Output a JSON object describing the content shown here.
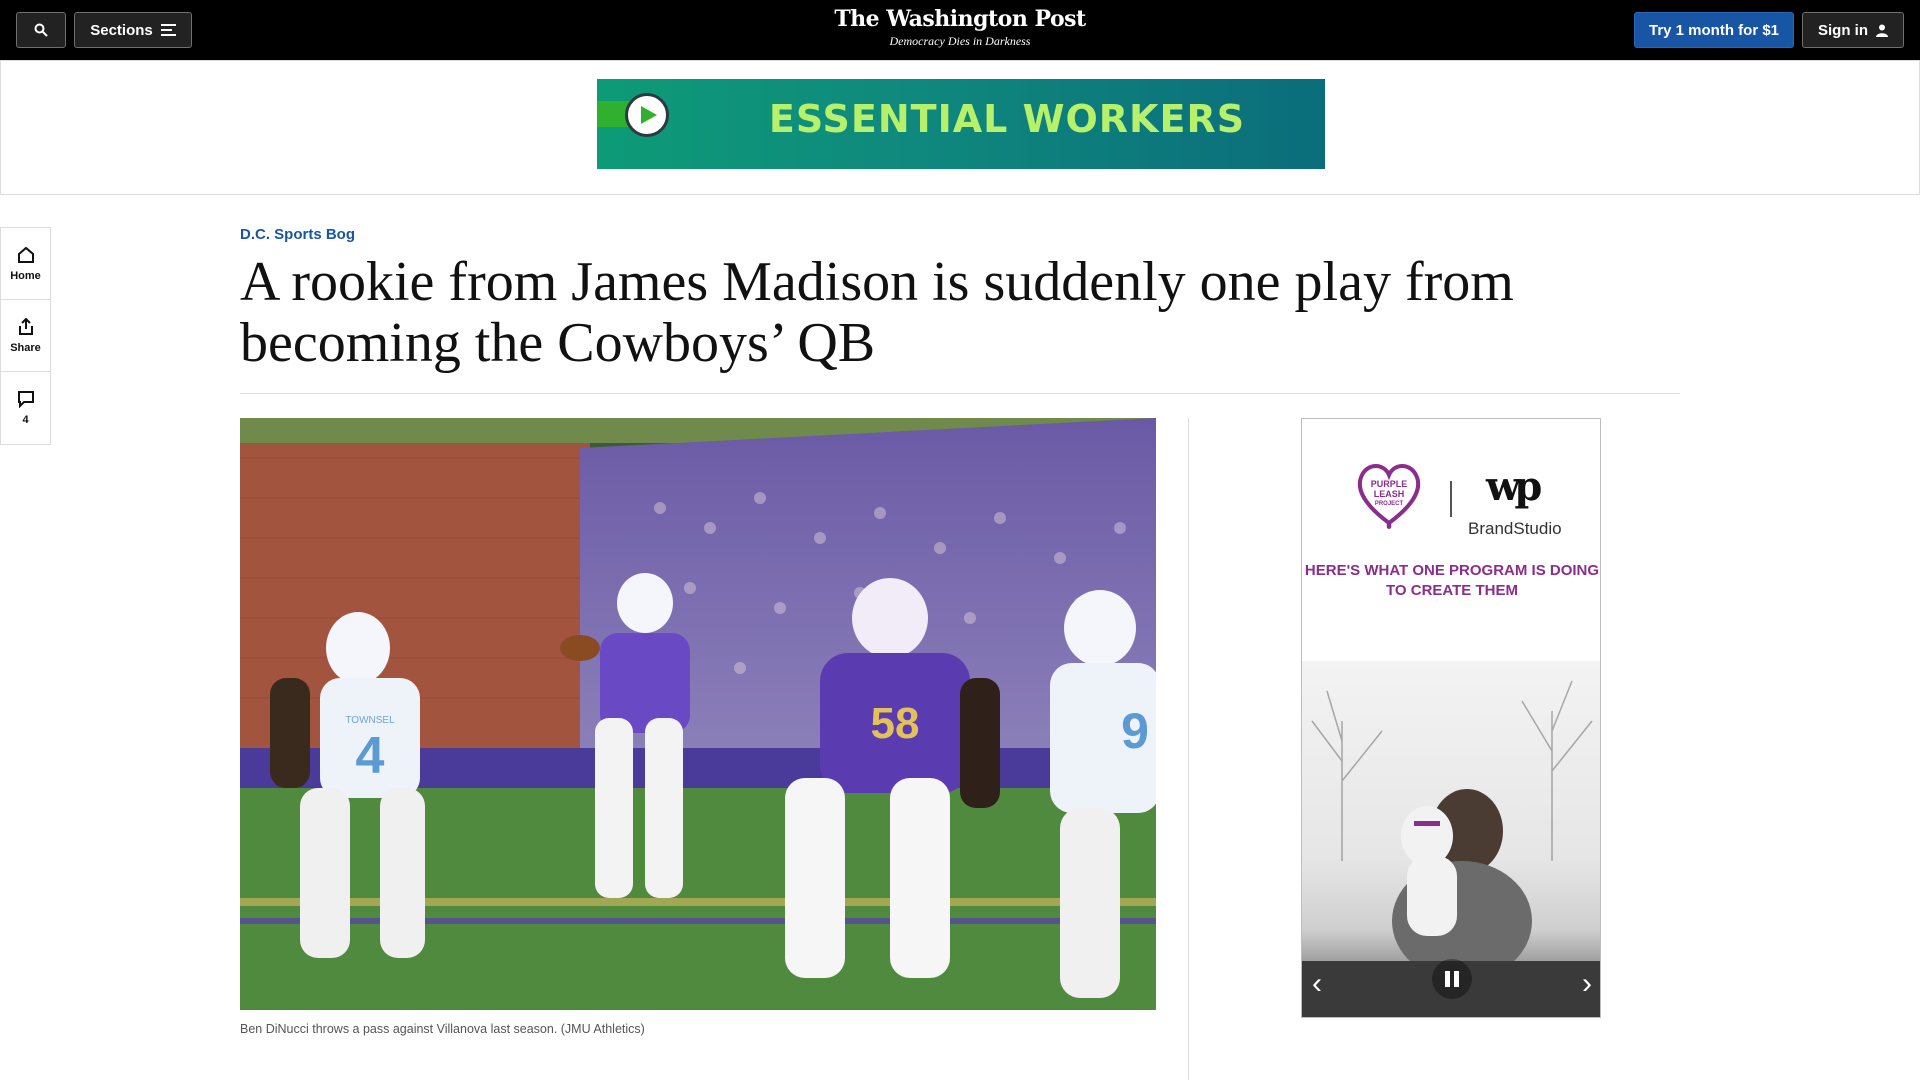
{
  "header": {
    "sections_label": "Sections",
    "logo_name": "The Washington Post",
    "tagline": "Democracy Dies in Darkness",
    "trial_label": "Try 1 month for $1",
    "signin_label": "Sign in"
  },
  "ad_banner": {
    "title": "ESSENTIAL WORKERS"
  },
  "left_rail": {
    "home_label": "Home",
    "share_label": "Share",
    "comments_count": "4"
  },
  "article": {
    "kicker": "D.C. Sports Bog",
    "headline": "A rookie from James Madison is suddenly one play from becoming the Cowboys’ QB",
    "caption": "Ben DiNucci throws a pass against Villanova last season. (JMU Athletics)"
  },
  "photo": {
    "jersey_left_name": "TOWNSEL",
    "jersey_left_number": "4",
    "jersey_center_number": "58",
    "jersey_right_number": "9"
  },
  "side_ad": {
    "brand_line1": "PURPLE",
    "brand_line2": "LEASH",
    "brand_line3": "PROJECT",
    "wp_mark": "wp",
    "brandstudio": "BrandStudio",
    "copy": "HERE'S WHAT ONE PROGRAM IS DOING TO CREATE THEM"
  },
  "colors": {
    "accent_blue": "#1955a5",
    "jmu_purple": "#5b3cb0",
    "ad_purple": "#8a2d8c",
    "ad_green": "#b7f06a"
  }
}
